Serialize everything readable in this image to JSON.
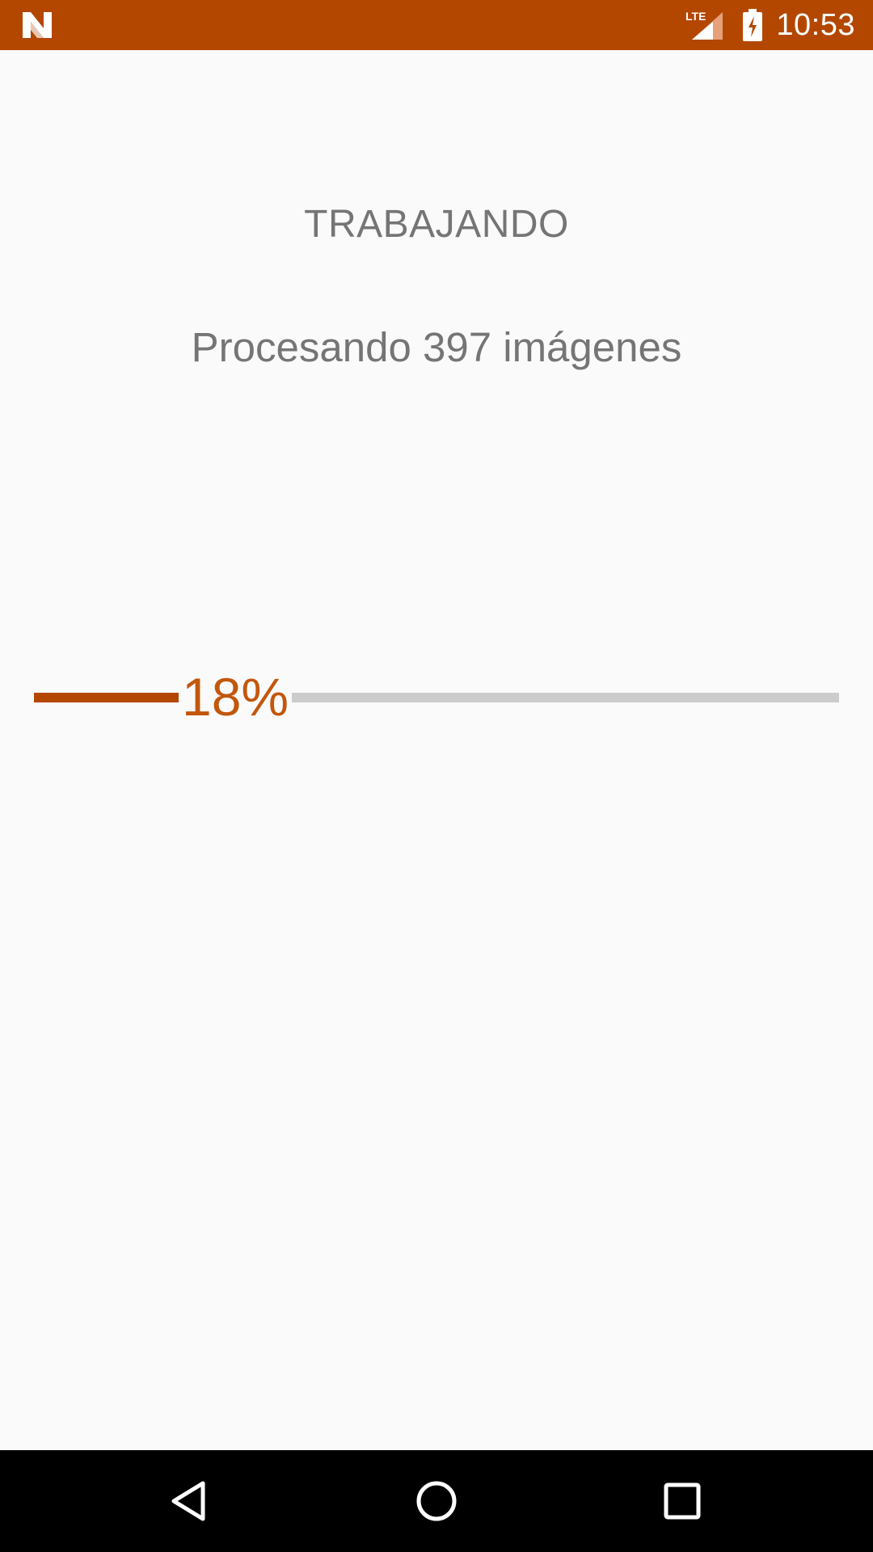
{
  "status_bar": {
    "time": "10:53",
    "network": "LTE",
    "background_color": "#b34700",
    "icons": [
      "n-logo-icon",
      "lte-signal-icon",
      "battery-charging-icon"
    ]
  },
  "main": {
    "title": "TRABAJANDO",
    "subtitle": "Procesando 397 imágenes"
  },
  "progress": {
    "value": 0.18,
    "label": "18%",
    "fill_color": "#b34700",
    "track_color": "#cccccc"
  },
  "nav_bar": {
    "buttons": [
      "back-icon",
      "home-icon",
      "recents-icon"
    ]
  }
}
